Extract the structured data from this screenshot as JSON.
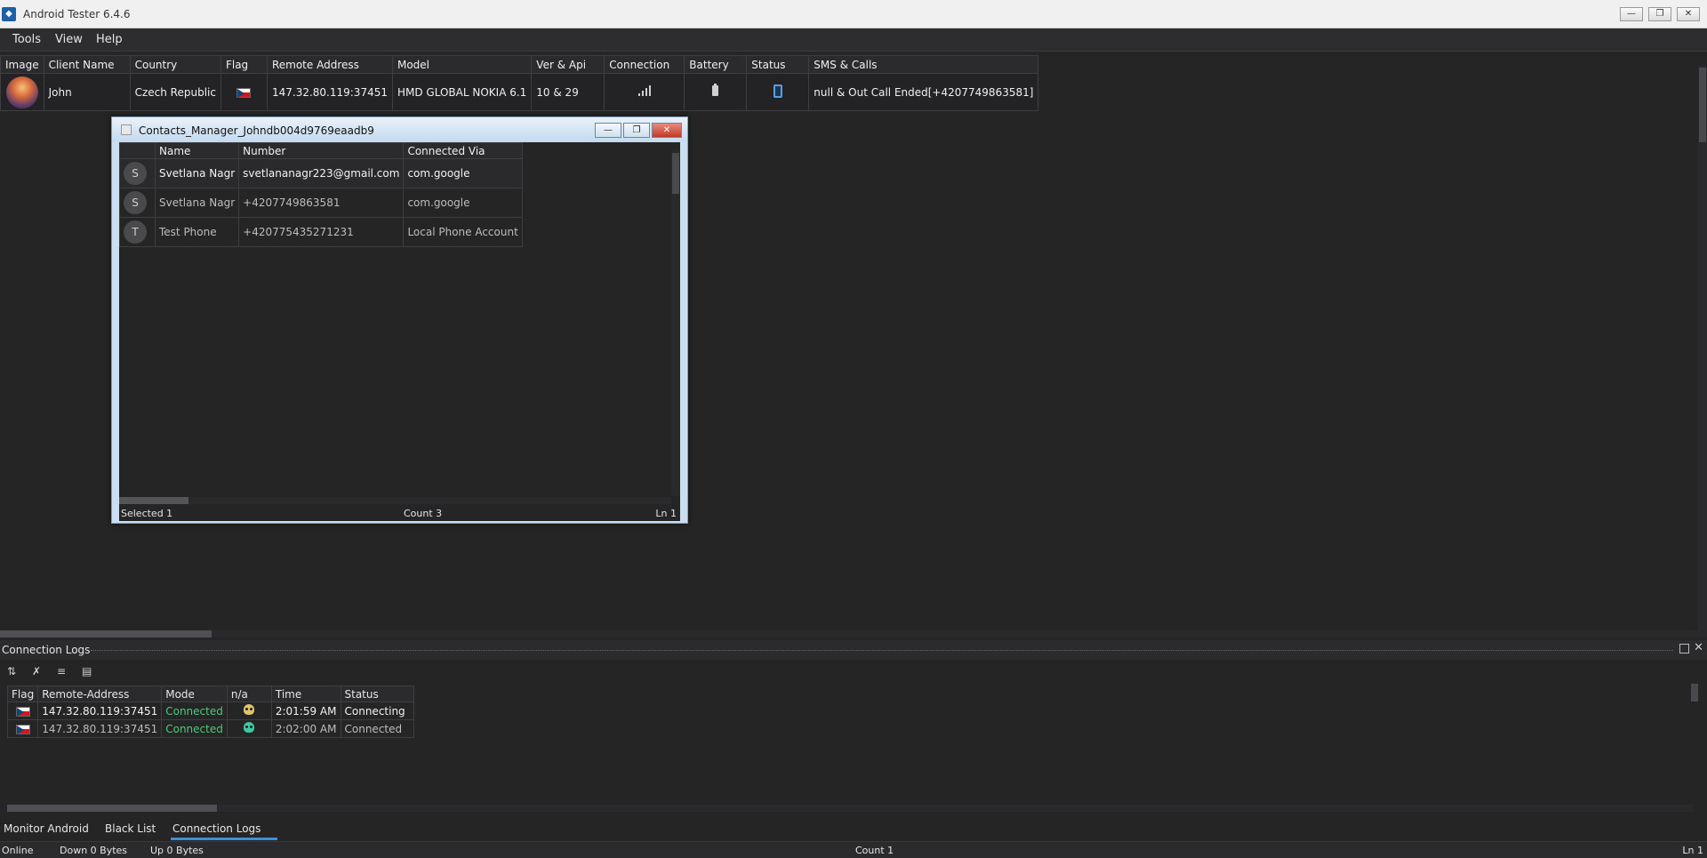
{
  "window": {
    "title": "Android Tester 6.4.6",
    "controls": {
      "minimize": "—",
      "restore": "❐",
      "close": "✕"
    }
  },
  "menu": [
    "Tools",
    "View",
    "Help"
  ],
  "clients": {
    "headers": [
      "Image",
      "Client Name",
      "Country",
      "Flag",
      "Remote Address",
      "Model",
      "Ver & Api",
      "Connection",
      "Battery",
      "Status",
      "SMS & Calls"
    ],
    "rows": [
      {
        "client_name": "John",
        "country": "Czech Republic",
        "remote_address": "147.32.80.119:37451",
        "model": "HMD GLOBAL NOKIA 6.1",
        "ver_api": "10 & 29",
        "sms_calls": "null & Out Call Ended[+4207749863581]"
      }
    ]
  },
  "contacts_dialog": {
    "title": "Contacts_Manager_Johndb004d9769eaadb9",
    "headers": [
      "Name",
      "Number",
      "Connected Via"
    ],
    "rows": [
      {
        "letter": "S",
        "name": "Svetlana Nagr",
        "number": "svetlananagr223@gmail.com",
        "via": "com.google"
      },
      {
        "letter": "S",
        "name": "Svetlana Nagr",
        "number": "+4207749863581",
        "via": "com.google"
      },
      {
        "letter": "T",
        "name": "Test Phone",
        "number": "+420775435271231",
        "via": "Local Phone Account"
      }
    ],
    "status": {
      "selected": "Selected 1",
      "count": "Count 3",
      "line": "Ln 1"
    }
  },
  "connection_logs": {
    "title": "Connection Logs",
    "headers": [
      "Flag",
      "Remote-Address",
      "Mode",
      "n/a",
      "Time",
      "Status"
    ],
    "rows": [
      {
        "remote": "147.32.80.119:37451",
        "mode": "Connected",
        "time": "2:01:59 AM",
        "status": "Connecting"
      },
      {
        "remote": "147.32.80.119:37451",
        "mode": "Connected",
        "time": "2:02:00 AM",
        "status": "Connected"
      }
    ]
  },
  "tabs": [
    "Monitor Android",
    "Black List",
    "Connection Logs"
  ],
  "statusbar": {
    "online": "Online",
    "down": "Down 0 Bytes",
    "up": "Up 0 Bytes",
    "count": "Count 1",
    "line": "Ln 1"
  },
  "colors": {
    "accent": "#3d8fd6",
    "connected_green": "#4ec97a"
  }
}
